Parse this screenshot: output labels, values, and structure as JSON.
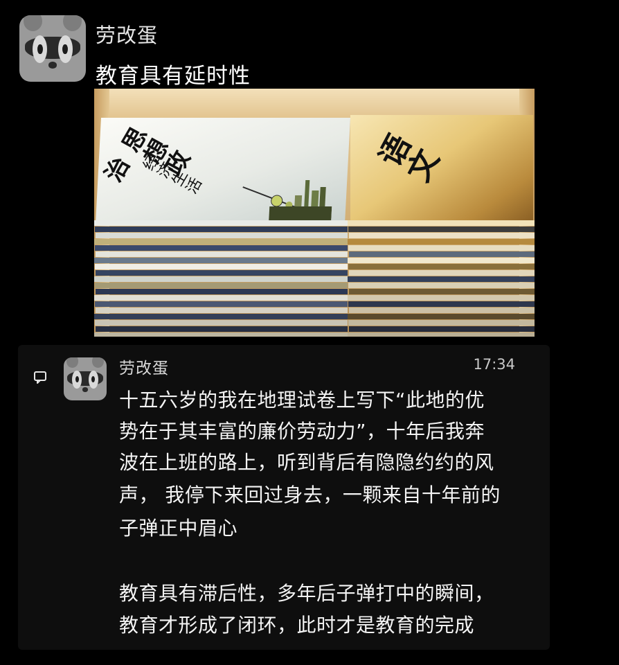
{
  "post": {
    "author": "劳改蛋",
    "text": "教育具有延时性",
    "photo": {
      "left_book_title": "思想政治",
      "left_book_subtitle": "经济生活",
      "right_book_title": "语文"
    }
  },
  "comment": {
    "author": "劳改蛋",
    "time": "17:34",
    "lines": [
      "十五六岁的我在地理试卷上写下“此地的优",
      "势在于其丰富的廉价劳动力”，十年后我奔",
      "波在上班的路上，听到背后有隐隐约约的风",
      "声， 我停下来回过身去，一颗来自十年前的",
      "子弹正中眉心",
      "",
      "教育具有滞后性，多年后子弹打中的瞬间，",
      "教育才形成了闭环，此时才是教育的完成"
    ]
  },
  "icons": {
    "avatar": "raccoon-avatar-icon",
    "comment": "comment-icon"
  },
  "colors": {
    "background": "#000000",
    "card": "#0e0e0e",
    "text": "#f4f4f4"
  }
}
